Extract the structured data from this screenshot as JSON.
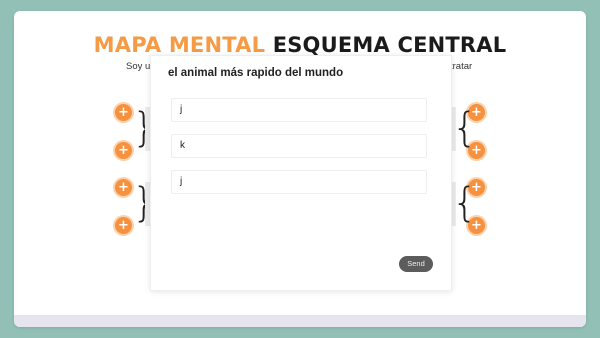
{
  "header": {
    "title_part1": "MAPA MENTAL",
    "title_part2": "ESQUEMA CENTRAL",
    "subtitle_left": "Soy u",
    "subtitle_right": "tratar"
  },
  "nodes": {
    "add_label": "+"
  },
  "modal": {
    "question": "el animal más rapido del mundo",
    "answers": [
      "j",
      "k",
      "j"
    ],
    "send_label": "Send"
  },
  "colors": {
    "background": "#93c0b6",
    "accent_orange": "#f5913f",
    "send_button": "#5c5c5c"
  }
}
